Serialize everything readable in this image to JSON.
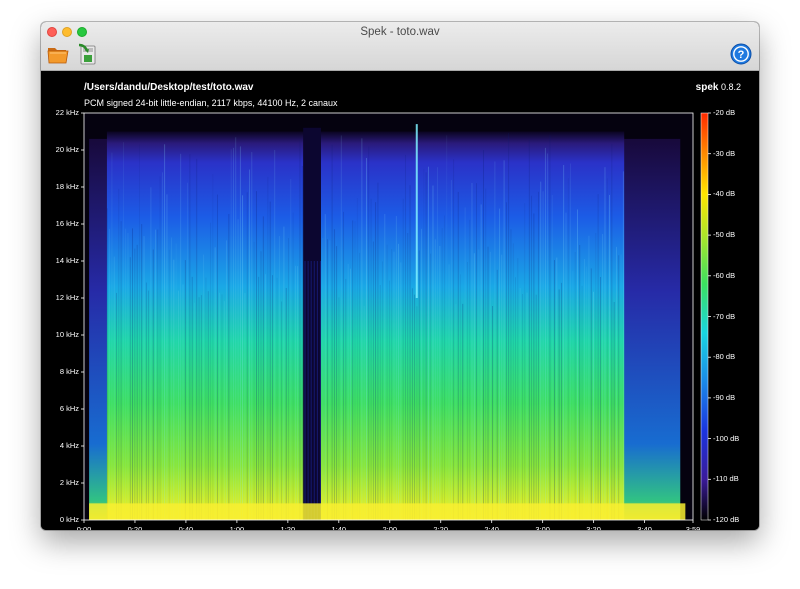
{
  "window": {
    "title": "Spek - toto.wav"
  },
  "toolbar": {
    "open_icon": "folder-open-icon",
    "save_icon": "save-arrow-icon",
    "help_icon": "help-question-icon"
  },
  "header": {
    "file_path": "/Users/dandu/Desktop/test/toto.wav",
    "file_info": "PCM signed 24-bit little-endian, 2117 kbps, 44100 Hz, 2 canaux",
    "app_name": "spek",
    "version": "0.8.2"
  },
  "chart_data": {
    "type": "heatmap",
    "title": "",
    "frequency_axis": {
      "unit": "kHz",
      "ylim": [
        0,
        22
      ],
      "ticks": [
        "0 kHz",
        "2 kHz",
        "4 kHz",
        "6 kHz",
        "8 kHz",
        "10 kHz",
        "12 kHz",
        "14 kHz",
        "16 kHz",
        "18 kHz",
        "20 kHz",
        "22 kHz"
      ]
    },
    "time_axis": {
      "xlim_seconds": [
        0,
        239
      ],
      "ticks": [
        "0:00",
        "0:20",
        "0:40",
        "1:00",
        "1:20",
        "1:40",
        "2:00",
        "2:20",
        "2:40",
        "3:00",
        "3:20",
        "3:40",
        "3:59"
      ]
    },
    "color_scale": {
      "unit": "dB",
      "range": [
        -120,
        -20
      ],
      "ticks": [
        "-20 dB",
        "-30 dB",
        "-40 dB",
        "-50 dB",
        "-60 dB",
        "-70 dB",
        "-80 dB",
        "-90 dB",
        "-100 dB",
        "-110 dB",
        "-120 dB"
      ],
      "colors_low_to_high": [
        "#000000",
        "#1a0a3a",
        "#3a1a9a",
        "#1a35e0",
        "#1a8ae8",
        "#19d6e0",
        "#3be060",
        "#aee628",
        "#ffe600",
        "#ff8a00",
        "#ff2a00"
      ]
    },
    "annotations": {
      "silent_gap_seconds": [
        86,
        93
      ],
      "lowpass_cutoff_khz": 21
    }
  }
}
